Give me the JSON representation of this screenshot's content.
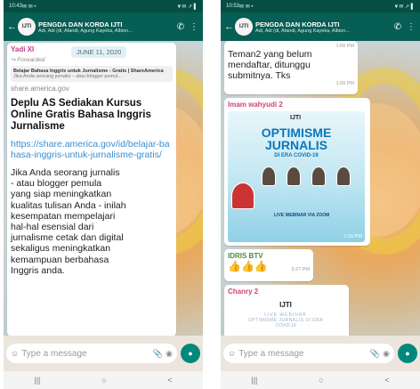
{
  "left": {
    "status": {
      "time": "10:43",
      "icons_left": "✉ ✉ •",
      "icons_right": "▼✉ ↗ ▌"
    },
    "header": {
      "title": "PENGDA DAN KORDA IJTI",
      "members": "Adi, Adi (di, Afandi, Agung Kayeka, Albion...",
      "back_icon": "back-arrow-icon",
      "call_icon": "call-icon",
      "menu_icon": "more-vert-icon"
    },
    "sender": "Yadi XI",
    "date_chip": "JUNE 11, 2020",
    "forwarded": "↪ Forwarded",
    "preview": {
      "title": "Belajar Bahasa Inggris untuk Jurnalisme - Gratis | ShareAmerica",
      "desc": "Jika Anda seorang jurnalis – atau blogger pemul...",
      "domain": "share.america.gov"
    },
    "headline": "Deplu AS Sediakan Kursus Online Gratis Bahasa Inggris Jurnalisme",
    "link": "https://share.america.gov/id/belajar-bahasa-inggris-untuk-jurnalisme-gratis/",
    "body": "Jika Anda seorang jurnalis\n- atau blogger pemula\nyang siap meningkatkan\nkualitas tulisan Anda - inilah\nkesempatan mempelajari\nhal-hal esensial dari\njurnalisme cetak dan digital\nsekaligus meningkatkan\nkemampuan berbahasa\nInggris anda.",
    "composer": {
      "placeholder": "Type a message"
    }
  },
  "right": {
    "status": {
      "time": "10:53",
      "icons_left": "✉ ✉ •",
      "icons_right": "▼✉ ↗ ▌"
    },
    "header": {
      "title": "PENGDA DAN KORDA IJTI",
      "members": "Adi, Adi (di, Afandi, Agung Kayeka, Albion...",
      "back_icon": "back-arrow-icon",
      "call_icon": "call-icon",
      "menu_icon": "more-vert-icon"
    },
    "messages": [
      {
        "text": "Teman2 yang belum\nmendaftar, ditunggu\nsubmitnya. Tks",
        "time_top": "1:09 PM",
        "time": "1:09 PM"
      },
      {
        "sender": "Imam wahyudi 2",
        "poster": {
          "logo": "IJTI",
          "title": "OPTIMISME\nJURNALIS",
          "subtitle": "DI ERA COVID-19",
          "live": "LIVE WEBINAR VIA ZOOM",
          "time": "1:26 PM"
        }
      },
      {
        "sender": "IDRIS BTV",
        "emoji": "👍👍👍",
        "time": "5:27 PM"
      },
      {
        "sender": "Chanry 2",
        "sticker": {
          "logo": "IJTI",
          "line1": "LIVE WEBINAR",
          "line2": "OPTIMISME JURNALIS DI ERA",
          "line3": "COVID-19"
        }
      }
    ],
    "composer": {
      "placeholder": "Type a message"
    }
  },
  "navbar": {
    "recent": "|||",
    "home": "○",
    "back": "<"
  },
  "colors": {
    "header": "#075e54",
    "mic": "#00897b",
    "link": "#3a8ecf"
  }
}
